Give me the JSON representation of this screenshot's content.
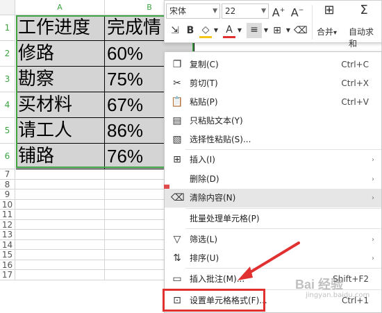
{
  "columns": [
    "A",
    "B"
  ],
  "rows": [
    "1",
    "2",
    "3",
    "4",
    "5",
    "6",
    "7",
    "8",
    "9",
    "10",
    "11",
    "12",
    "13",
    "14",
    "15",
    "16",
    "17"
  ],
  "table": [
    [
      "工作进度",
      "完成情"
    ],
    [
      "修路",
      "60%"
    ],
    [
      "勘察",
      "75%"
    ],
    [
      "买材料",
      "67%"
    ],
    [
      "请工人",
      "86%"
    ],
    [
      "铺路",
      "76%"
    ]
  ],
  "toolbar": {
    "font_name": "宋体",
    "font_size": "22",
    "increase_font": "A⁺",
    "decrease_font": "A⁻",
    "merge_label": "合并",
    "merge_arrow": "▾",
    "autosum_label": "自动求和",
    "format_painter_label": "",
    "icons": [
      "format-painter-icon",
      "bold-icon",
      "fill-color-icon",
      "font-color-icon",
      "align-icon",
      "borders-icon",
      "eraser-icon"
    ]
  },
  "menu": {
    "items": [
      {
        "icon": "copy-icon",
        "label": "复制(C)",
        "shortcut": "Ctrl+C",
        "submenu": false
      },
      {
        "icon": "cut-icon",
        "label": "剪切(T)",
        "shortcut": "Ctrl+X",
        "submenu": false
      },
      {
        "icon": "paste-icon",
        "label": "粘贴(P)",
        "shortcut": "Ctrl+V",
        "submenu": false
      },
      {
        "icon": "paste-text-icon",
        "label": "只粘贴文本(Y)",
        "shortcut": "",
        "submenu": false
      },
      {
        "icon": "paste-special-icon",
        "label": "选择性粘贴(S)...",
        "shortcut": "",
        "submenu": false
      },
      {
        "icon": "insert-icon",
        "label": "插入(I)",
        "shortcut": "",
        "submenu": true
      },
      {
        "icon": "",
        "label": "删除(D)",
        "shortcut": "",
        "submenu": true
      },
      {
        "icon": "clear-icon",
        "label": "清除内容(N)",
        "shortcut": "",
        "submenu": true,
        "highlighted": true
      },
      {
        "icon": "",
        "label": "批量处理单元格(P)",
        "shortcut": "",
        "submenu": false
      },
      {
        "icon": "filter-icon",
        "label": "筛选(L)",
        "shortcut": "",
        "submenu": true
      },
      {
        "icon": "sort-icon",
        "label": "排序(U)",
        "shortcut": "",
        "submenu": true
      },
      {
        "icon": "comment-icon",
        "label": "插入批注(M)...",
        "shortcut": "Shift+F2",
        "submenu": false
      },
      {
        "icon": "format-cells-icon",
        "label": "设置单元格格式(F)...",
        "shortcut": "Ctrl+1",
        "submenu": false
      }
    ],
    "submenu_arrow": "›"
  },
  "watermark": "Bai 经验",
  "watermark_sub": "jingyan.baidu.com",
  "colors": {
    "selection": "#3ca340",
    "highlight_box": "#e03030",
    "arrow": "#e03030",
    "cell_fill": "#d4d4d4"
  }
}
